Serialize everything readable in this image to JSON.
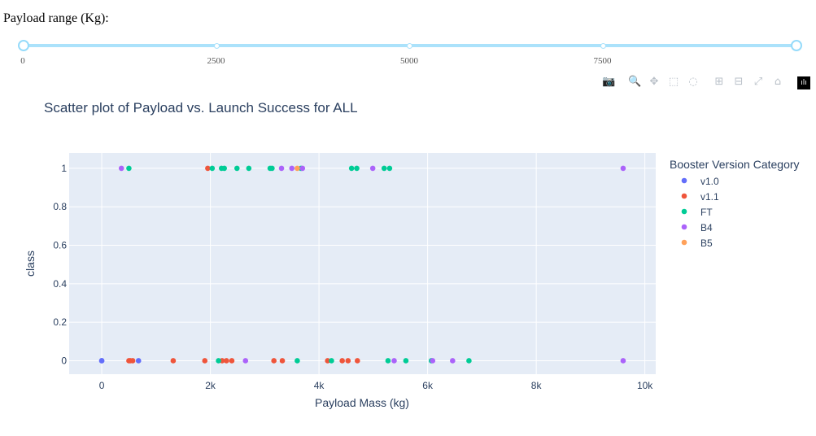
{
  "slider": {
    "label": "Payload range (Kg):",
    "min": 0,
    "max": 10000,
    "selected_min": 0,
    "selected_max": 10000,
    "marks": [
      {
        "value": 0,
        "label": "0"
      },
      {
        "value": 2500,
        "label": "2500"
      },
      {
        "value": 5000,
        "label": "5000"
      },
      {
        "value": 7500,
        "label": "7500"
      }
    ]
  },
  "modebar": [
    {
      "name": "camera-icon",
      "glyph": "📷"
    },
    {
      "name": "zoom-icon",
      "glyph": "🔍"
    },
    {
      "name": "pan-icon",
      "glyph": "✥"
    },
    {
      "name": "box-select-icon",
      "glyph": "⬚"
    },
    {
      "name": "lasso-select-icon",
      "glyph": "◌"
    },
    {
      "name": "zoom-in-icon",
      "glyph": "⊞"
    },
    {
      "name": "zoom-out-icon",
      "glyph": "⊟"
    },
    {
      "name": "autoscale-icon",
      "glyph": "⤢"
    },
    {
      "name": "reset-axes-icon",
      "glyph": "⌂"
    },
    {
      "name": "plotly-logo-icon",
      "glyph": "ılı"
    }
  ],
  "chart_data": {
    "type": "scatter",
    "title": "Scatter plot of Payload vs. Launch Success for ALL",
    "xlabel": "Payload Mass (kg)",
    "ylabel": "class",
    "xlim": [
      -600,
      10200
    ],
    "ylim": [
      -0.07,
      1.08
    ],
    "x_ticks": [
      0,
      2000,
      4000,
      6000,
      8000,
      10000
    ],
    "x_tick_labels": [
      "0",
      "2k",
      "4k",
      "6k",
      "8k",
      "10k"
    ],
    "y_ticks": [
      0,
      0.2,
      0.4,
      0.6,
      0.8,
      1
    ],
    "y_tick_labels": [
      "0",
      "0.2",
      "0.4",
      "0.6",
      "0.8",
      "1"
    ],
    "grid": true,
    "legend": {
      "title": "Booster Version Category",
      "position": "right"
    },
    "series": [
      {
        "name": "v1.0",
        "color": "#636efa",
        "points": [
          [
            0,
            0
          ],
          [
            0,
            0
          ],
          [
            677,
            0
          ]
        ]
      },
      {
        "name": "v1.1",
        "color": "#ef553b",
        "points": [
          [
            500,
            0
          ],
          [
            525,
            0
          ],
          [
            570,
            0
          ],
          [
            1316,
            0
          ],
          [
            1898,
            0
          ],
          [
            1952,
            1
          ],
          [
            2296,
            0
          ],
          [
            2216,
            0
          ],
          [
            2395,
            0
          ],
          [
            3170,
            0
          ],
          [
            3325,
            0
          ],
          [
            4159,
            0
          ],
          [
            4428,
            0
          ],
          [
            4535,
            0
          ],
          [
            4707,
            0
          ]
        ]
      },
      {
        "name": "FT",
        "color": "#00cc96",
        "points": [
          [
            500,
            1
          ],
          [
            2034,
            1
          ],
          [
            2150,
            0
          ],
          [
            2205,
            1
          ],
          [
            2257,
            1
          ],
          [
            2490,
            1
          ],
          [
            2708,
            1
          ],
          [
            3100,
            1
          ],
          [
            3136,
            1
          ],
          [
            3600,
            0
          ],
          [
            3669,
            1
          ],
          [
            4230,
            0
          ],
          [
            4600,
            1
          ],
          [
            4696,
            1
          ],
          [
            5200,
            1
          ],
          [
            5271,
            0
          ],
          [
            5300,
            1
          ],
          [
            5600,
            0
          ],
          [
            6070,
            0
          ],
          [
            6761,
            0
          ]
        ]
      },
      {
        "name": "B4",
        "color": "#ab63fa",
        "points": [
          [
            362,
            1
          ],
          [
            2647,
            0
          ],
          [
            3310,
            1
          ],
          [
            3500,
            1
          ],
          [
            3696,
            1
          ],
          [
            4990,
            1
          ],
          [
            5384,
            0
          ],
          [
            6460,
            0
          ],
          [
            6092,
            0
          ],
          [
            9600,
            1
          ],
          [
            9600,
            0
          ]
        ]
      },
      {
        "name": "B5",
        "color": "#ffa15a",
        "points": [
          [
            3600,
            1
          ]
        ]
      }
    ]
  }
}
